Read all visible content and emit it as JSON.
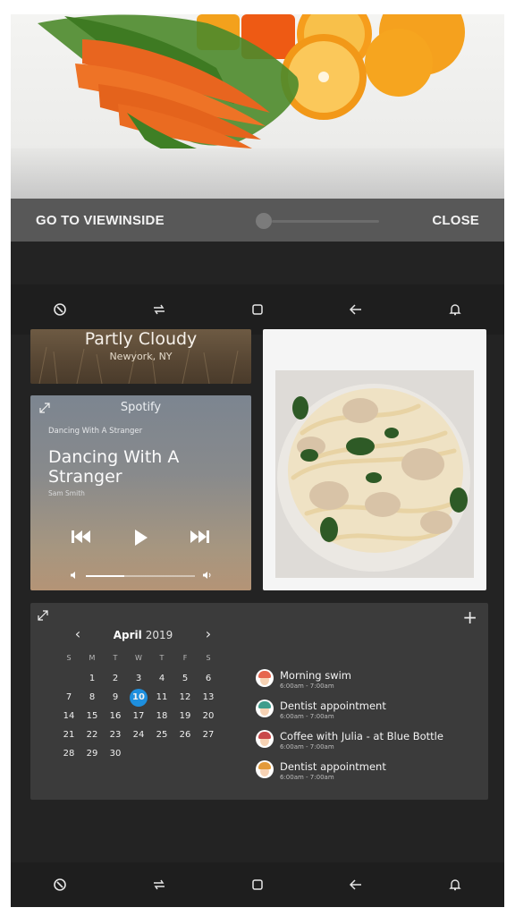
{
  "viewinside": {
    "go_label": "GO TO VIEWINSIDE",
    "close_label": "CLOSE"
  },
  "weather": {
    "condition": "Partly Cloudy",
    "location": "Newyork, NY"
  },
  "spotify": {
    "app_name": "Spotify",
    "small_title": "Dancing With A Stranger",
    "title": "Dancing With A Stranger",
    "artist": "Sam Smith",
    "volume": 0.35
  },
  "calendar": {
    "month": "April",
    "year": "2019",
    "weekdays": [
      "S",
      "M",
      "T",
      "W",
      "T",
      "F",
      "S"
    ],
    "weeks": [
      [
        "",
        "1",
        "2",
        "3",
        "4",
        "5",
        "6"
      ],
      [
        "7",
        "8",
        "9",
        "10",
        "11",
        "12",
        "13"
      ],
      [
        "14",
        "15",
        "16",
        "17",
        "18",
        "19",
        "20"
      ],
      [
        "21",
        "22",
        "23",
        "24",
        "25",
        "26",
        "27"
      ],
      [
        "28",
        "29",
        "30",
        "",
        "",
        "",
        ""
      ],
      [
        "",
        "",
        "",
        "",
        "",
        "",
        ""
      ]
    ],
    "selected_day": "10",
    "events": [
      {
        "title": "Morning swim",
        "time": "6:00am - 7:00am",
        "hair_color": "#e6664e"
      },
      {
        "title": "Dentist appointment",
        "time": "6:00am - 7:00am",
        "hair_color": "#3f9d8c"
      },
      {
        "title": "Coffee with Julia - at Blue Bottle",
        "time": "6:00am - 7:00am",
        "hair_color": "#c94a4a"
      },
      {
        "title": "Dentist appointment",
        "time": "6:00am - 7:00am",
        "hair_color": "#e39a3a"
      }
    ]
  },
  "colors": {
    "accent": "#1e8fde",
    "background": "#232323",
    "card": "#3b3b3b"
  }
}
